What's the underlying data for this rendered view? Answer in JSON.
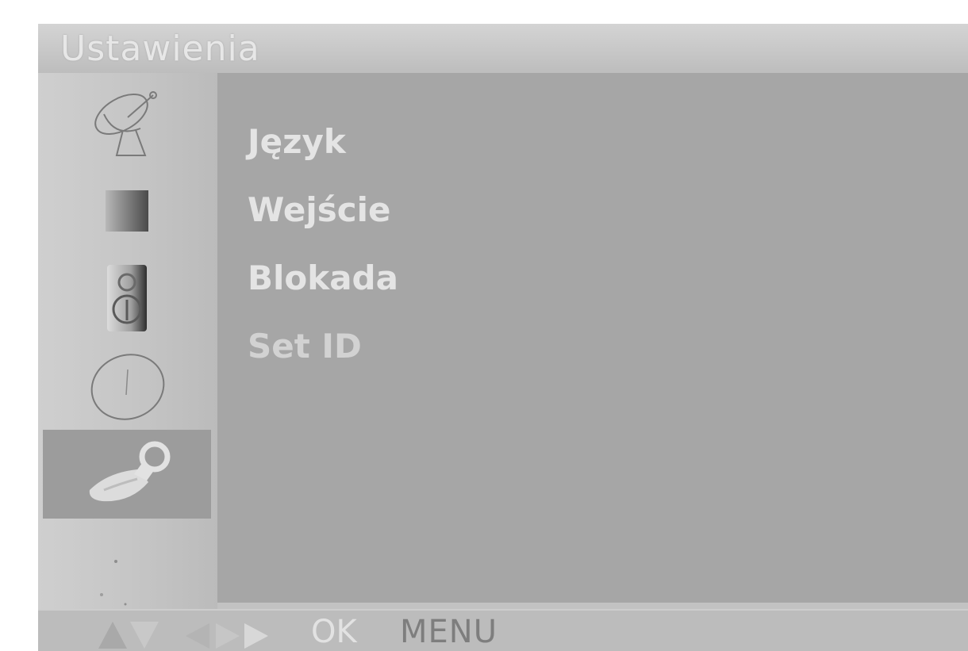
{
  "title": "Ustawienia",
  "category_icons": [
    {
      "name": "satellite-dish-icon",
      "selected": false
    },
    {
      "name": "picture-icon",
      "selected": false
    },
    {
      "name": "speaker-icon",
      "selected": false
    },
    {
      "name": "clock-icon",
      "selected": false
    },
    {
      "name": "wrench-icon",
      "selected": true
    }
  ],
  "menu_items": [
    {
      "label": "Język"
    },
    {
      "label": "Wejście"
    },
    {
      "label": "Blokada"
    },
    {
      "label": "Set ID"
    }
  ],
  "hint_bar": {
    "nav_icons": [
      "up-down-arrows-icon",
      "left-right-arrows-icon"
    ],
    "ok_label": "OK",
    "menu_label": "MENU"
  },
  "colors": {
    "panel": "#a6a6a6",
    "selected_icon_bg": "#9c9c9c",
    "text": "#e4e4e4"
  }
}
